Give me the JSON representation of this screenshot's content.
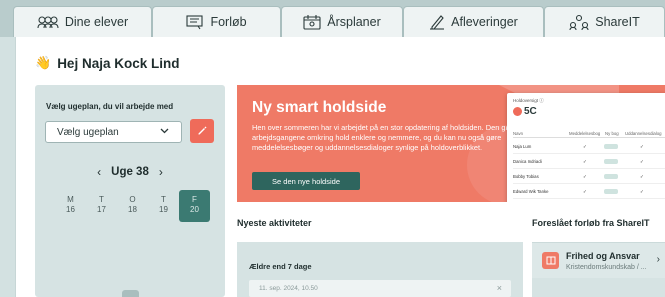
{
  "tabs": [
    {
      "label": "Dine elever",
      "icon": "students-icon"
    },
    {
      "label": "Forløb",
      "icon": "course-icon"
    },
    {
      "label": "Årsplaner",
      "icon": "calendar-icon"
    },
    {
      "label": "Afleveringer",
      "icon": "pen-icon"
    },
    {
      "label": "ShareIT",
      "icon": "share-icon"
    }
  ],
  "greeting": {
    "emoji": "👋",
    "text": "Hej Naja Kock Lind"
  },
  "weekplan": {
    "title": "Vælg ugeplan, du vil arbejde med",
    "select_value": "Vælg ugeplan",
    "week_label": "Uge 38",
    "prev": "‹",
    "next": "›",
    "days": [
      {
        "letter": "M",
        "date": "16"
      },
      {
        "letter": "T",
        "date": "17"
      },
      {
        "letter": "O",
        "date": "18"
      },
      {
        "letter": "T",
        "date": "19"
      },
      {
        "letter": "F",
        "date": "20"
      }
    ],
    "active_day_index": 4
  },
  "promo": {
    "title": "Ny smart holdside",
    "text": "Hen over sommeren har vi arbejdet på en stor opdatering af holdsiden. Den gør arbejdsgangene omkring hold enklere og nemmere, og du kan nu også gøre meddelelsesbøger og uddannelsesdialoger synlige på holdoverblikket.",
    "button": "Se den nye holdside",
    "mock": {
      "class_name": "5C",
      "headers": [
        "Navn",
        "Meddelelsesbog",
        "Ny bog",
        "Uddannelsesdialog"
      ],
      "rows": [
        "Naja Lum",
        "Danica Indriadi",
        "Bobby Tobias",
        "Edward Wik Tanke"
      ]
    }
  },
  "activities": {
    "title": "Nyeste aktiviteter",
    "group_label": "Ældre end 7 dage",
    "item_time": "11. sep. 2024, 10.50",
    "close": "×"
  },
  "suggestions": {
    "title": "Foreslået forløb fra ShareIT",
    "item_name": "Frihed og Ansvar",
    "item_meta": "Kristendomskundskab / ...",
    "arrow": "›"
  },
  "colors": {
    "accent": "#ef7a66",
    "primary": "#2e655e",
    "active_day": "#3b7a72"
  }
}
